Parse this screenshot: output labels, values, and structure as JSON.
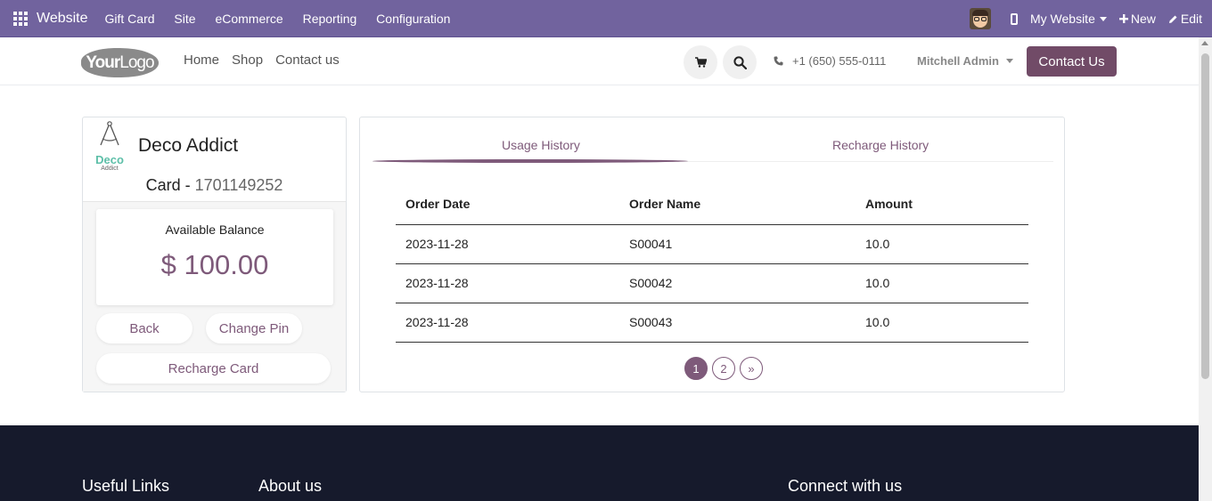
{
  "topbar": {
    "brand": "Website",
    "menu": [
      "Gift Card",
      "Site",
      "eCommerce",
      "Reporting",
      "Configuration"
    ],
    "my_website": "My Website",
    "new_label": "New",
    "edit_label": "Edit",
    "color": "#71639e"
  },
  "header": {
    "nav": [
      "Home",
      "Shop",
      "Contact us"
    ],
    "phone": "+1 (650) 555-0111",
    "user": "Mitchell Admin",
    "contact_button": "Contact Us"
  },
  "card": {
    "company": "Deco Addict",
    "logo_word": "Deco",
    "logo_sub": "Addict",
    "card_label": "Card - ",
    "card_number": "1701149252",
    "balance_label": "Available Balance",
    "balance": "$ 100.00",
    "back_button": "Back",
    "change_pin_button": "Change Pin",
    "recharge_button": "Recharge Card"
  },
  "history": {
    "tabs": [
      "Usage History",
      "Recharge History"
    ],
    "active_tab": "Usage History",
    "columns": [
      "Order Date",
      "Order Name",
      "Amount"
    ],
    "rows": [
      [
        "2023-11-28",
        "S00041",
        "10.0"
      ],
      [
        "2023-11-28",
        "S00042",
        "10.0"
      ],
      [
        "2023-11-28",
        "S00043",
        "10.0"
      ]
    ],
    "pages": [
      "1",
      "2",
      "»"
    ],
    "current_page": "1"
  },
  "footer": {
    "headings": [
      "Useful Links",
      "About us",
      "Connect with us"
    ]
  },
  "colors": {
    "accent": "#714b67",
    "footer_bg": "#161a2c"
  }
}
